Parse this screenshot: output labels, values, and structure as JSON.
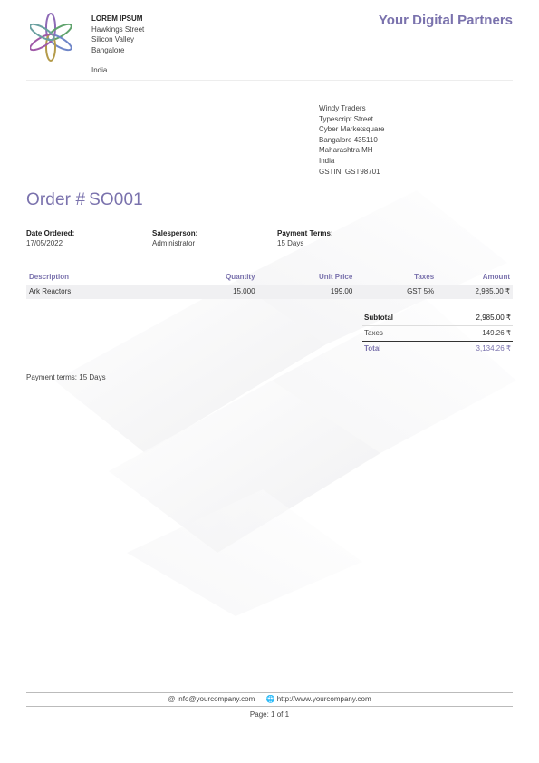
{
  "colors": {
    "accent": "#7a72ad",
    "row_bg": "#f0f0f2"
  },
  "company": {
    "name": "LOREM IPSUM",
    "address_lines": [
      "Hawkings Street",
      "Silicon Valley",
      "Bangalore"
    ],
    "country": "India",
    "tagline": "Your Digital Partners"
  },
  "customer": {
    "lines": [
      "Windy Traders",
      "Typescript Street",
      "Cyber Marketsquare",
      "Bangalore 435110",
      "Maharashtra MH",
      "India",
      "GSTIN: GST98701"
    ]
  },
  "order": {
    "label": "Order #",
    "number": "SO001"
  },
  "info": {
    "date_label": "Date Ordered:",
    "date_value": "17/05/2022",
    "salesperson_label": "Salesperson:",
    "salesperson_value": "Administrator",
    "terms_label": "Payment Terms:",
    "terms_value": "15 Days"
  },
  "table": {
    "headers": [
      "Description",
      "Quantity",
      "Unit Price",
      "Taxes",
      "Amount"
    ],
    "rows": [
      [
        "Ark Reactors",
        "15.000",
        "199.00",
        "GST 5%",
        "2,985.00 ₹"
      ]
    ]
  },
  "totals": {
    "subtotal_label": "Subtotal",
    "subtotal_value": "2,985.00 ₹",
    "taxes_label": "Taxes",
    "taxes_value": "149.26 ₹",
    "total_label": "Total",
    "total_value": "3,134.26 ₹"
  },
  "note": "Payment terms: 15 Days",
  "footer": {
    "email_icon": "at-icon",
    "email": "info@yourcompany.com",
    "web_icon": "globe-icon",
    "website": "http://www.yourcompany.com",
    "page": "Page: 1 of 1"
  }
}
